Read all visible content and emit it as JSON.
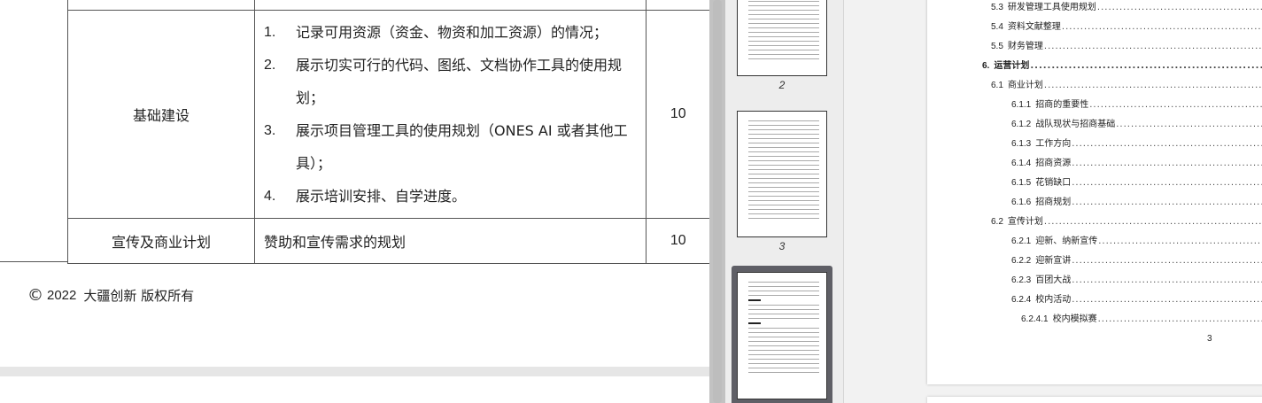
{
  "document": {
    "table": {
      "rows": [
        {
          "category": "基础建设",
          "requirements": [
            {
              "num": "1.",
              "text": "记录可用资源（资金、物资和加工资源）的情况；"
            },
            {
              "num": "2.",
              "text": "展示切实可行的代码、图纸、文档协作工具的使用规划；"
            },
            {
              "num": "3.",
              "text": "展示项目管理工具的使用规划（ONES AI 或者其他工具）；"
            },
            {
              "num": "4.",
              "text": "展示培训安排、自学进度。"
            }
          ],
          "score": "10"
        },
        {
          "category": "宣传及商业计划",
          "description": "赞助和宣传需求的规划",
          "score": "10"
        }
      ]
    },
    "footer": {
      "copyright_symbol": "©",
      "year": "2022",
      "text": "大疆创新 版权所有"
    }
  },
  "thumbnails": [
    {
      "label": "2"
    },
    {
      "label": "3"
    },
    {
      "label": "",
      "selected": true
    }
  ],
  "toc": {
    "entries": [
      {
        "num": "5.3",
        "title": "研发管理工具使用规划",
        "level": 2
      },
      {
        "num": "5.4",
        "title": "资料文献整理",
        "level": 2
      },
      {
        "num": "5.5",
        "title": "财务管理",
        "level": 2
      },
      {
        "num": "6.",
        "title": "运营计划",
        "level": 1
      },
      {
        "num": "6.1",
        "title": "商业计划",
        "level": 2
      },
      {
        "num": "6.1.1",
        "title": "招商的重要性",
        "level": 3
      },
      {
        "num": "6.1.2",
        "title": "战队现状与招商基础",
        "level": 3
      },
      {
        "num": "6.1.3",
        "title": "工作方向",
        "level": 3
      },
      {
        "num": "6.1.4",
        "title": "招商资源",
        "level": 3
      },
      {
        "num": "6.1.5",
        "title": "花销缺口",
        "level": 3
      },
      {
        "num": "6.1.6",
        "title": "招商规划",
        "level": 3
      },
      {
        "num": "6.2",
        "title": "宣传计划",
        "level": 2
      },
      {
        "num": "6.2.1",
        "title": "迎新、纳新宣传",
        "level": 3
      },
      {
        "num": "6.2.2",
        "title": "迎新宣讲",
        "level": 3
      },
      {
        "num": "6.2.3",
        "title": "百团大战",
        "level": 3
      },
      {
        "num": "6.2.4",
        "title": "校内活动",
        "level": 3
      },
      {
        "num": "6.2.4.1",
        "title": "校内模拟赛",
        "level": 4
      }
    ],
    "page_number": "3"
  }
}
